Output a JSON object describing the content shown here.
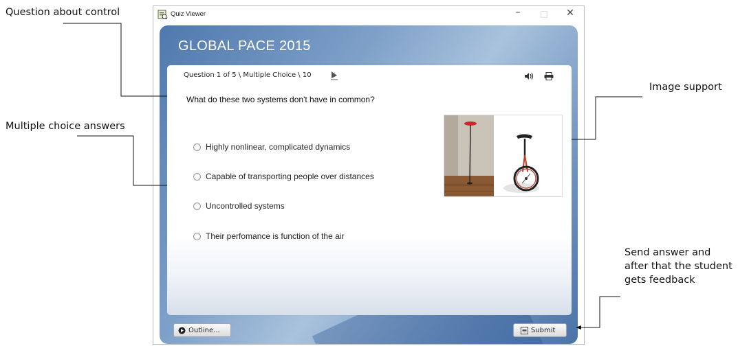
{
  "annotations": {
    "question_about_control": "Question about control",
    "multiple_choice_answers": "Multiple choice answers",
    "image_support": "Image support",
    "send_answer": [
      "Send answer and",
      "after that the student",
      "gets feedback"
    ]
  },
  "window": {
    "title": "Quiz Viewer",
    "minimize": "–",
    "maximize": "□",
    "close": "✕"
  },
  "course": {
    "title": "GLOBAL PACE 2015"
  },
  "slide": {
    "question_info": "Question 1 of 5 \\ Multiple Choice \\ 10",
    "question": "What do these two systems don't have in common?",
    "answers": [
      "Highly nonlinear, complicated dynamics",
      "Capable of transporting people over distances",
      "Uncontrolled systems",
      "Their perfomance is function of the air"
    ]
  },
  "controls": {
    "outline_label": "Outline...",
    "submit_label": "Submit"
  },
  "icons": [
    "quiz-viewer-app-icon",
    "play-icon",
    "audio-icon",
    "print-icon",
    "outline-play-icon",
    "submit-list-icon"
  ],
  "colors": {
    "player_blue": "#5a80b2",
    "annotation_text": "#111111"
  }
}
